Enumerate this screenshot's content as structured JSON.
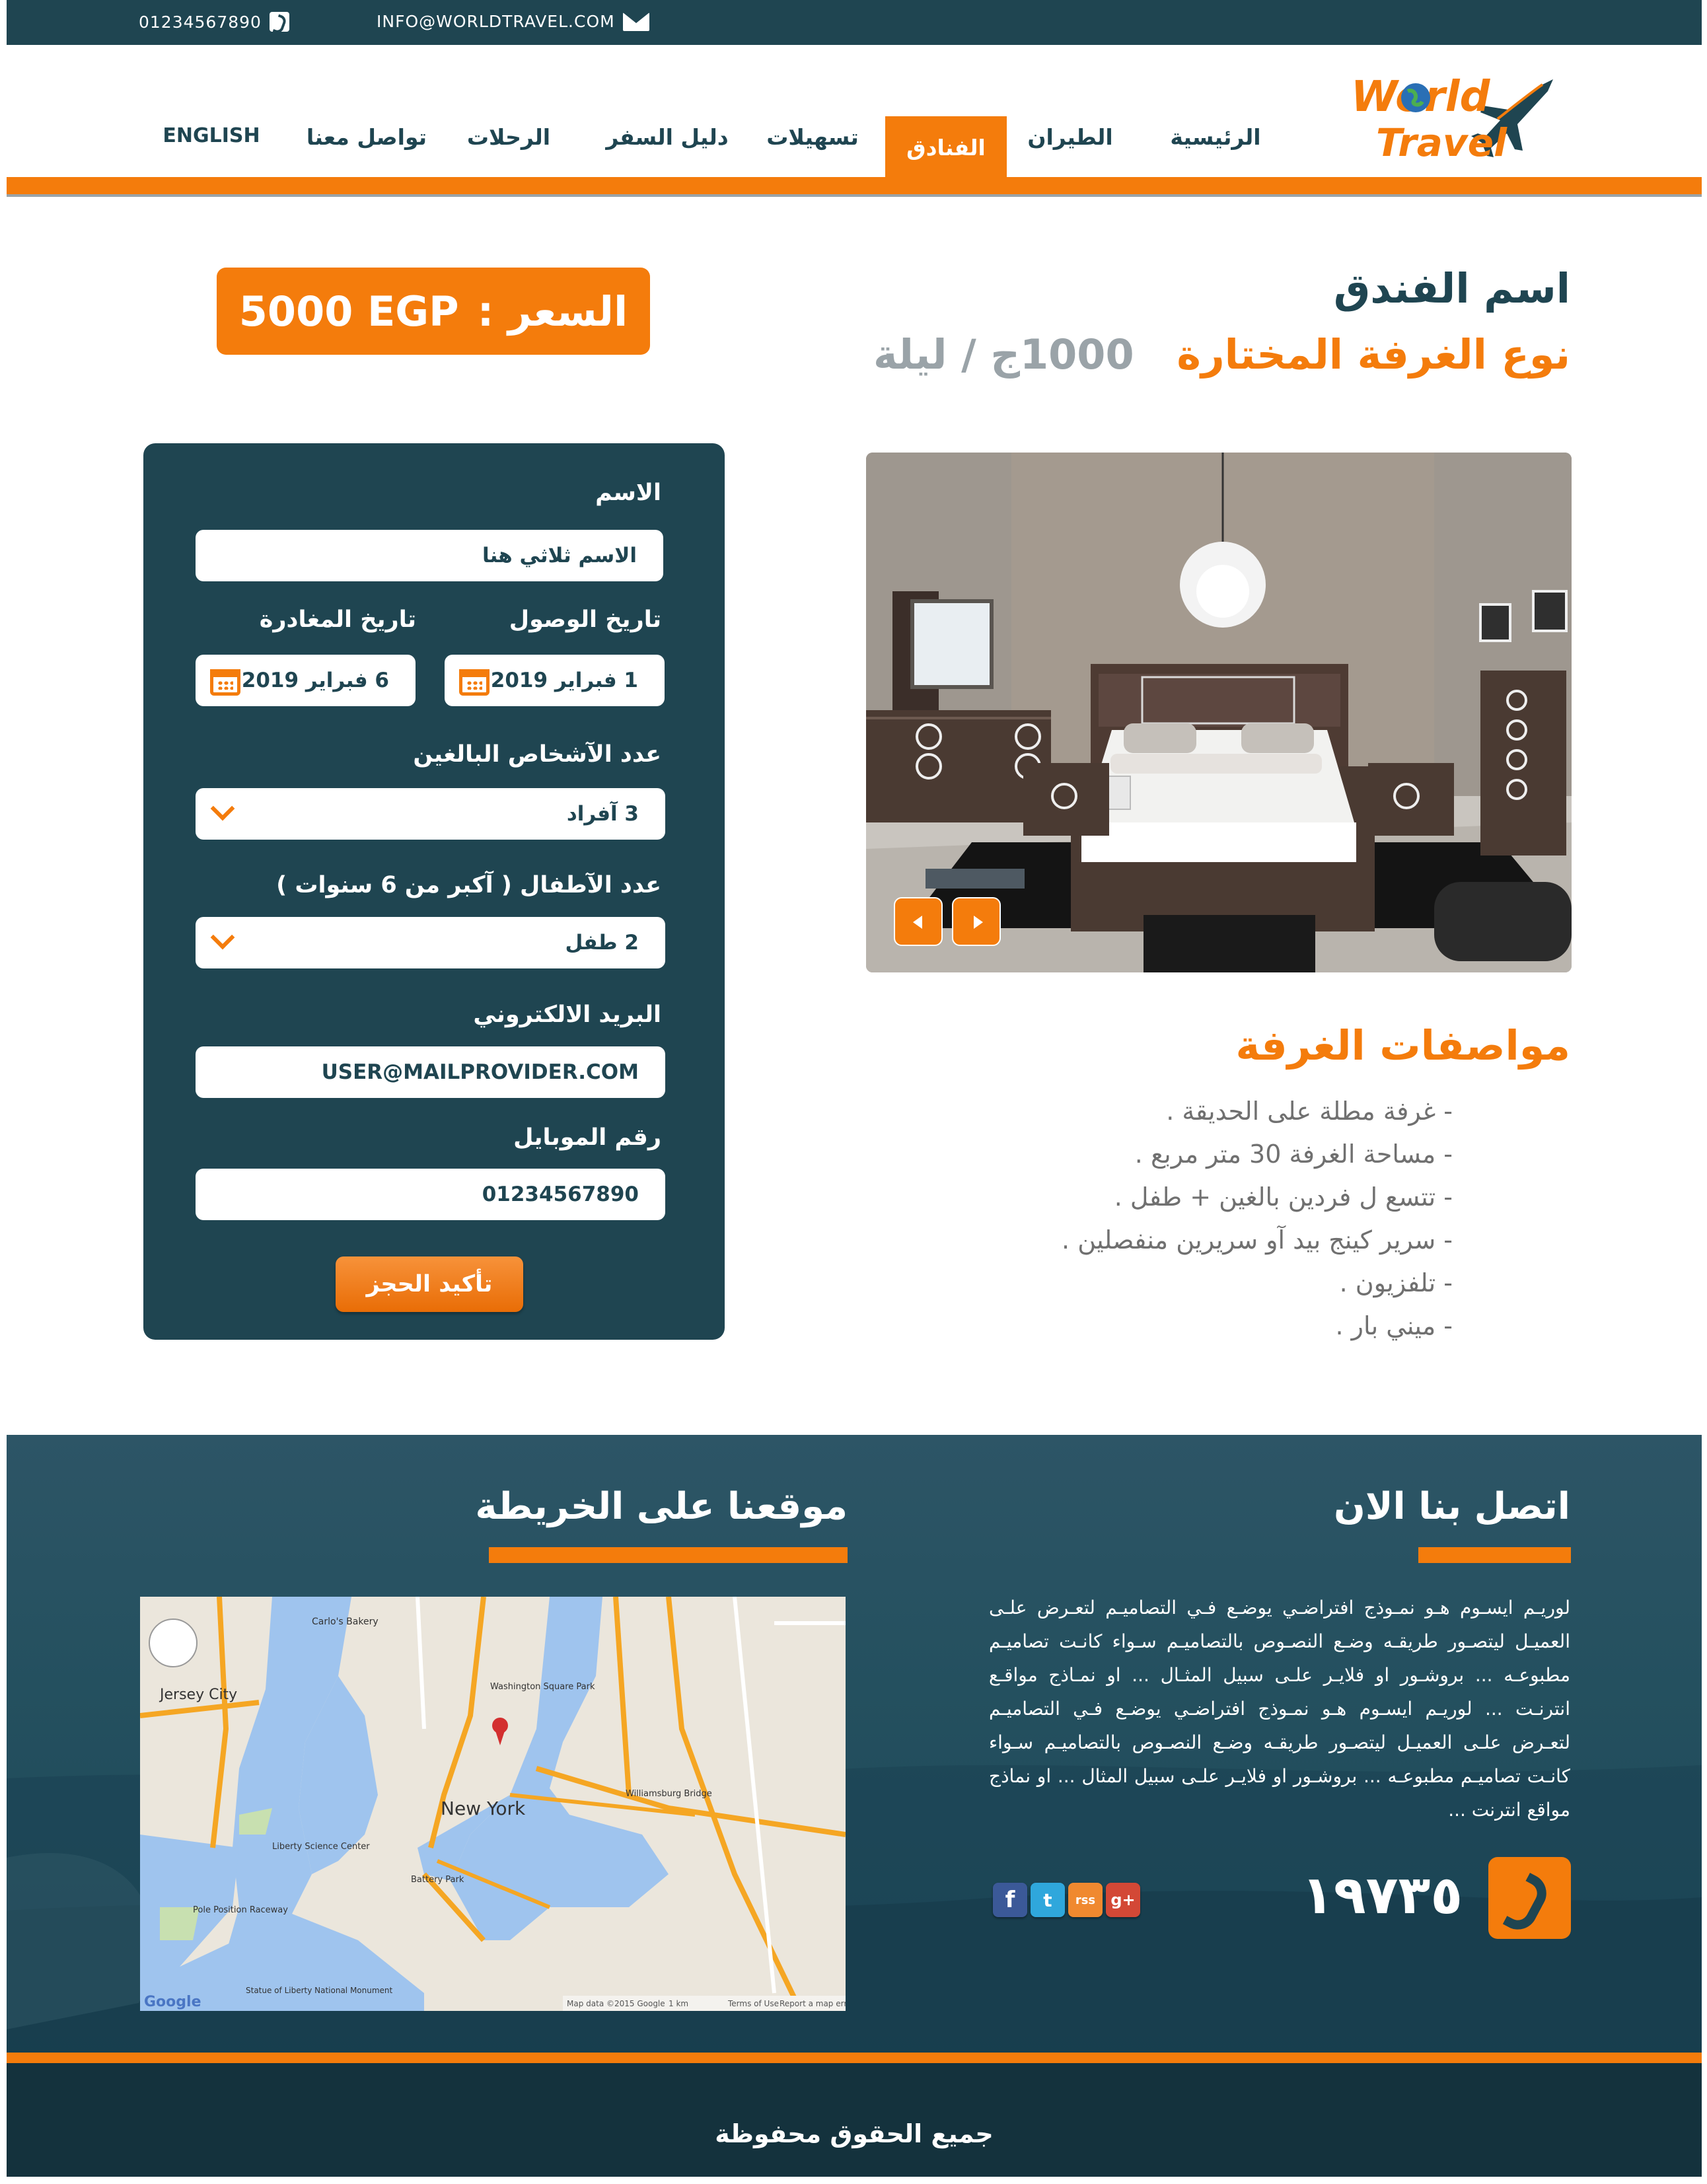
{
  "topbar": {
    "phone": "01234567890",
    "email": "INFO@WORLDTRAVEL.COM"
  },
  "logo": {
    "line1": "World",
    "line2": "Travel"
  },
  "nav": {
    "home": "الرئيسية",
    "flights": "الطيران",
    "hotels": "الفنادق",
    "facilities": "تسهيلات",
    "guide": "دليل السفر",
    "trips": "الرحلات",
    "contact": "تواصل معنا",
    "english": "ENGLISH"
  },
  "hotel": {
    "name": "اسم الفندق",
    "room_type": "نوع الغرفة المختارة",
    "room_rate": "1000ج / ليلة",
    "price_label": "السعر :",
    "price_value": "5000 EGP"
  },
  "form": {
    "name_label": "الاسم",
    "name_value": "الاسم ثلاثي هنا",
    "arrival_label": "تاريخ الوصول",
    "arrival_value": "1 فبراير 2019",
    "departure_label": "تاريخ المغادرة",
    "departure_value": "6 فبراير 2019",
    "adults_label": "عدد الآشخاص البالغين",
    "adults_value": "3 آفراد",
    "children_label": "عدد الآطفال ( آكبر من 6 سنوات )",
    "children_value": "2 طفل",
    "email_label": "البريد الالكتروني",
    "email_value": "USER@MAILPROVIDER.COM",
    "mobile_label": "رقم الموبايل",
    "mobile_value": "01234567890",
    "submit": "تأكيد الحجز"
  },
  "specs": {
    "title": "مواصفات الغرفة",
    "items": [
      "- غرفة مطلة على الحديقة .",
      "- مساحة الغرفة 30 متر مربع .",
      "- تتسع ل فردين بالغين + طفل .",
      "- سرير كينج  بيد آو سريرين منفصلين .",
      "- تلفزيون .",
      "- ميني بار ."
    ]
  },
  "contact": {
    "title": "اتصل بنا الان",
    "text": "لوريـم ايسـوم هـو نمـوذج افتراضـي يوضـع فـي التصاميـم لتعـرض علـى العميـل ليتصـور طريقـه وضـع النصـوص بالتصاميـم سـواء كانـت تصاميـم مطبوعـه ... بروشـور او فلايـر علـى سبيل المثـال ... او نمـاذج مواقـع انترنـت ... لوريـم ايسـوم هـو نمـوذج افتراضـي يوضـع فـي التصاميـم لتعـرض علـى العميـل ليتصـور طريقـه وضـع النصـوص بالتصاميـم سـواء كانـت تصاميـم مطبوعـه ... بروشـور او فلايـر علـى سبيل المثال ... او نماذج مواقع انترنت ...",
    "hotline": "١٩٧٣٥"
  },
  "map_section": {
    "title": "موقعنا على الخريطة",
    "labels": {
      "city_new_york": "New York",
      "jersey_city": "Jersey City",
      "carlos": "Carlo's Bakery",
      "washington": "Washington Square Park",
      "williamsburg_bridge": "Williamsburg Bridge",
      "liberty": "Liberty Science Center",
      "battery": "Battery Park",
      "statue": "Statue of Liberty National Monument",
      "pole": "Pole Position Raceway",
      "google": "Google",
      "mapdata": "Map data ©2015 Google",
      "scale": "1 km",
      "terms": "Terms of Use",
      "report": "Report a map error"
    }
  },
  "social": {
    "facebook": "f",
    "twitter": "t",
    "rss": "rss",
    "google": "g+"
  },
  "footer": {
    "copyright": "جميع الحقوق محفوظة"
  },
  "colors": {
    "primary": "#1f4551",
    "accent": "#f47c0c",
    "muted": "#9aa3a8"
  }
}
